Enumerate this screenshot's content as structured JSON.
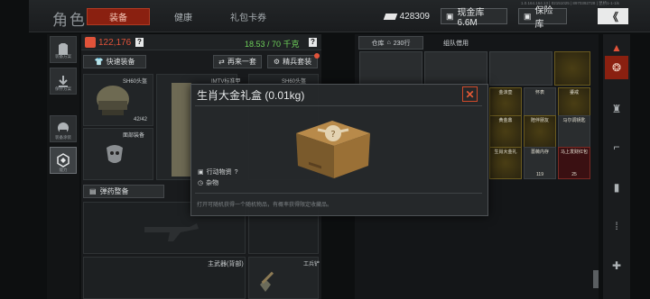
{
  "header": {
    "title": "角色",
    "tabs": [
      {
        "label": "装备",
        "active": true
      },
      {
        "label": "健康",
        "active": false
      },
      {
        "label": "礼包卡券",
        "active": false
      }
    ],
    "version_text": "1.0.164.164.13 | 02151025 | 8970392728 | 昆桥1-1-1ls",
    "currency": "428309",
    "cash_vault": "现金库 6.6M",
    "safe_vault": "保险库",
    "back_label": "《"
  },
  "left_nav": {
    "items": [
      {
        "label": "装备方案"
      },
      {
        "label": "保存方案"
      },
      {
        "label": "装备涂装"
      },
      {
        "label": "能力"
      }
    ]
  },
  "loadout": {
    "value": "122,176",
    "help": "?",
    "weight": "18.53 / 70 千克",
    "quick_equip": "快速装备",
    "again": "再来一套",
    "elite": "精兵套装",
    "helmet_name": "SH60头盔",
    "helmet_durability": "42/42",
    "armor_name": "IMTV标准甲",
    "face_label": "面部装备",
    "rig_name": "SH60头盔",
    "ammo_tab": "弹药整备",
    "primary_label": "主武器(背部)",
    "tool_label": "工兵铲"
  },
  "storage": {
    "tab_storage": "仓库",
    "tab_rows": "230行",
    "tab_team": "组队借用",
    "items": [
      {
        "label": ""
      },
      {
        "label": ""
      },
      {
        "label": ""
      },
      {
        "label": ""
      },
      {
        "label": "金沫壶"
      },
      {
        "label": "怀表"
      },
      {
        "label": "鎏戒"
      },
      {
        "label": "黄金鼎"
      },
      {
        "label": "陪伴朋友"
      },
      {
        "label": "马尔调钥匙"
      },
      {
        "label": "生肖大金礼"
      },
      {
        "label": "蔷薇内存"
      },
      {
        "label": "马上发财红包"
      },
      {
        "label": "119"
      },
      {
        "label": "25"
      }
    ]
  },
  "popup": {
    "title": "生肖大金礼盒 (0.01kg)",
    "category": "行动物资",
    "category_help": "?",
    "subtype": "杂物",
    "description": "打开可随机获得一个随机物品，有概率获得限定收藏品。",
    "close": "✕"
  },
  "colors": {
    "accent_red": "#8a2010",
    "value_red": "#e0533a",
    "weight_green": "#6ed05a",
    "gold": "#c89a3a"
  }
}
